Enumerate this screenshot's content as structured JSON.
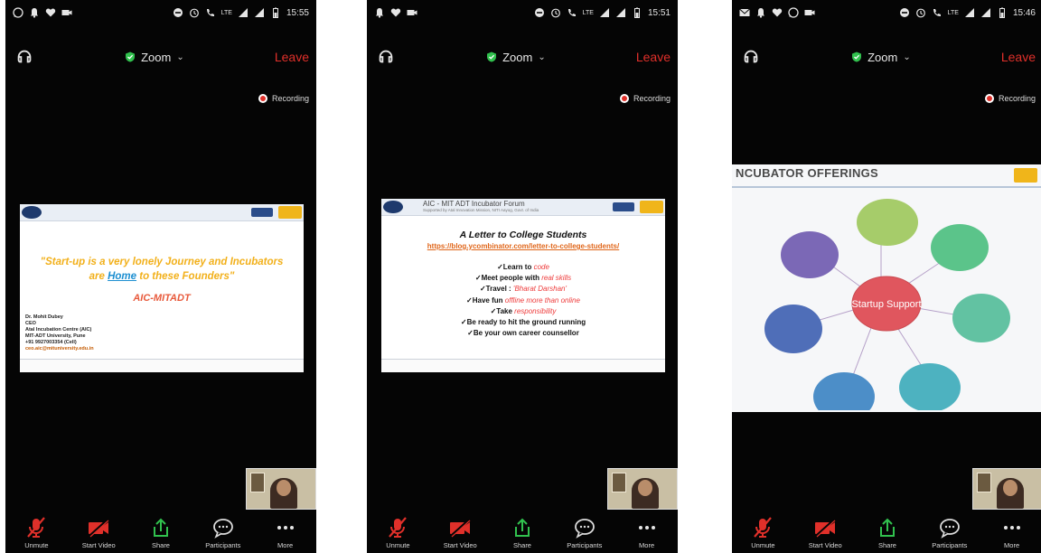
{
  "colors": {
    "leave": "#e0302a",
    "shield": "#31c14e",
    "mic_off": "#e0302a",
    "video_off": "#e0302a",
    "share": "#31c14e",
    "accent_quote": "#f2b01a",
    "accent_org": "#e85a3c"
  },
  "phones": [
    {
      "status": {
        "time": "15:55",
        "network": "LTE"
      },
      "meeting_title": "Zoom",
      "leave": "Leave",
      "recording": "Recording",
      "slide": {
        "quote_part1": "\"Start-up is a very lonely Journey and Incubators",
        "quote_part2": "are",
        "quote_home": "Home",
        "quote_part3": "to these Founders\"",
        "org": "AIC-MITADT",
        "contact": [
          "Dr. Mohit Dubey",
          "CEO",
          "Atal Incubation Centre (AIC)",
          "MIT-ADT University, Pune",
          "+91 9927003354 (Cell)"
        ],
        "email": "ceo.aic@mituniversity.edu.in"
      }
    },
    {
      "status": {
        "time": "15:51",
        "network": "LTE"
      },
      "meeting_title": "Zoom",
      "leave": "Leave",
      "recording": "Recording",
      "slide": {
        "head_title": "AIC - MIT ADT Incubator Forum",
        "head_sub": "Supported by Atal Innovation Mission, NITI Aayog, Govt. of India",
        "title": "A Letter to College Students",
        "url": "https://blog.ycombinator.com/letter-to-college-students/",
        "bullets": [
          {
            "text": "✓Learn to ",
            "hl": "code"
          },
          {
            "text": "✓Meet people with ",
            "hl": "real skills"
          },
          {
            "text": "✓Travel : ",
            "hl": "'Bharat Darshan'"
          },
          {
            "text": "✓Have fun ",
            "hl": "offline more than online"
          },
          {
            "text": "✓Take ",
            "hl": "responsibility"
          },
          {
            "text": "✓Be ready to hit the ground running",
            "hl": ""
          },
          {
            "text": "✓Be your own career counsellor",
            "hl": ""
          }
        ]
      }
    },
    {
      "status": {
        "time": "15:46",
        "network": "LTE"
      },
      "meeting_title": "Zoom",
      "leave": "Leave",
      "recording": "Recording",
      "slide": {
        "title": "NCUBATOR OFFERINGS",
        "center": "Startup Support"
      }
    }
  ],
  "toolbar": [
    {
      "label": "Unmute",
      "icon": "mic-off-icon"
    },
    {
      "label": "Start Video",
      "icon": "video-off-icon"
    },
    {
      "label": "Share",
      "icon": "share-icon"
    },
    {
      "label": "Participants",
      "icon": "chat-bubble-icon"
    },
    {
      "label": "More",
      "icon": "more-icon"
    }
  ]
}
